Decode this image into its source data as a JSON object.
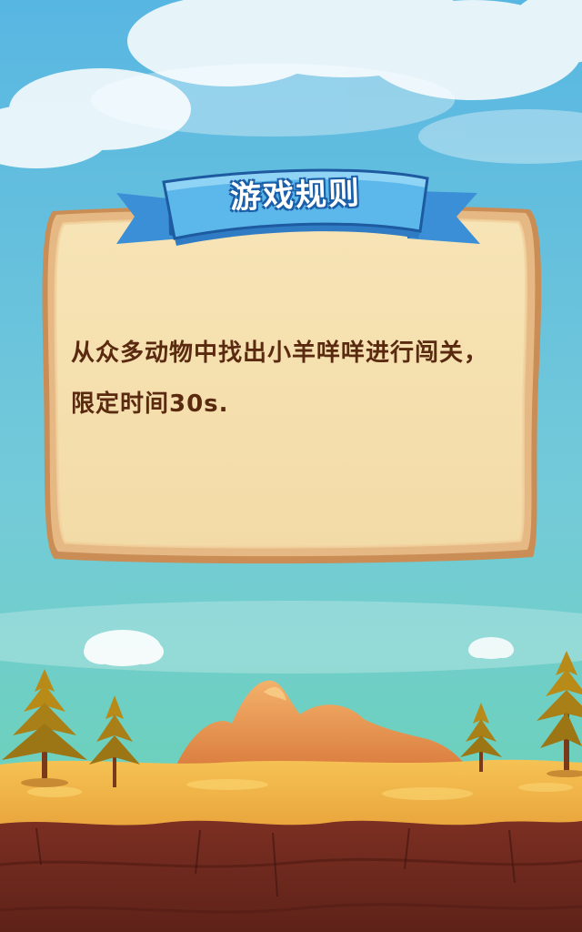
{
  "rules_panel": {
    "title": "游戏规则",
    "lines": [
      "从众多动物中找出小羊咩咩进行闯关，",
      "限定时间30s."
    ]
  },
  "colors": {
    "sky_top": "#5ab8e0",
    "sky_bottom": "#6fd3c0",
    "panel_fill": "#f6e3b3",
    "panel_border": "#d9a36a",
    "ribbon_blue": "#59b4e8",
    "ribbon_dark": "#2b6fb8",
    "text_brown": "#5a2a10",
    "ground_sand": "#f0b84a",
    "ground_soil": "#7a2e22"
  }
}
